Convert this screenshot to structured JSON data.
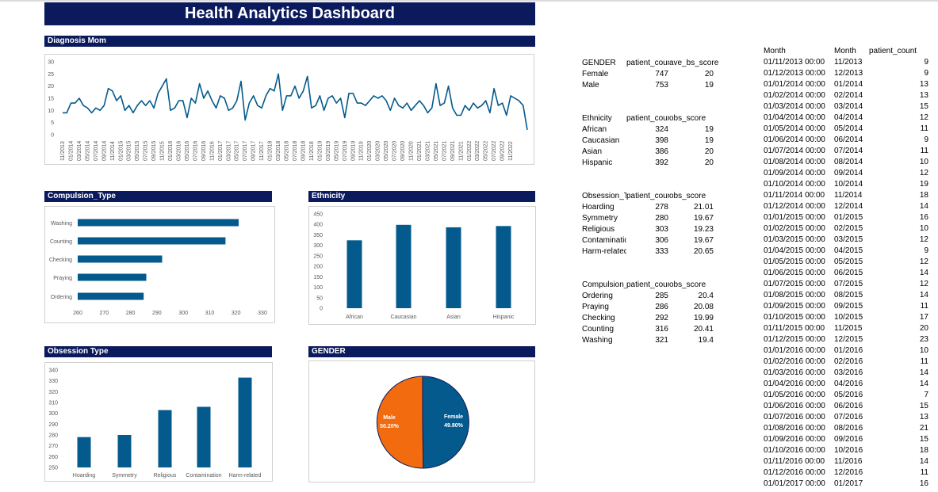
{
  "dashboard": {
    "title": "Health Analytics Dashboard"
  },
  "diagnosis": {
    "header": "Diagnosis Mom",
    "y_ticks": [
      "30",
      "25",
      "20",
      "15",
      "10",
      "5",
      "0"
    ],
    "x_labels": [
      "11/2013",
      "01/2014",
      "03/2014",
      "05/2014",
      "07/2014",
      "09/2014",
      "11/2014",
      "01/2015",
      "03/2015",
      "05/2015",
      "07/2015",
      "09/2015",
      "11/2015",
      "01/2016",
      "03/2016",
      "05/2016",
      "07/2016",
      "09/2016",
      "11/2016",
      "01/2017",
      "03/2017",
      "05/2017",
      "07/2017",
      "09/2017",
      "11/2017",
      "01/2018",
      "03/2018",
      "05/2018",
      "07/2018",
      "09/2018",
      "11/2018",
      "01/2019",
      "03/2019",
      "05/2019",
      "07/2019",
      "09/2019",
      "11/2019",
      "01/2020",
      "03/2020",
      "05/2020",
      "07/2020",
      "09/2020",
      "11/2020",
      "01/2021",
      "03/2021",
      "05/2021",
      "07/2021",
      "09/2021",
      "11/2021",
      "01/2022",
      "03/2022",
      "05/2022",
      "07/2022",
      "09/2022",
      "11/2022"
    ]
  },
  "compulsion": {
    "header": "Compulsion_Type",
    "x_ticks": [
      "260",
      "270",
      "280",
      "290",
      "300",
      "310",
      "320",
      "330"
    ]
  },
  "ethnicity": {
    "header": "Ethnicity",
    "y_ticks": [
      "450",
      "400",
      "350",
      "300",
      "250",
      "200",
      "150",
      "100",
      "50",
      "0"
    ]
  },
  "obsession": {
    "header": "Obsession Type",
    "y_ticks": [
      "340",
      "330",
      "320",
      "310",
      "300",
      "290",
      "280",
      "270",
      "260",
      "250"
    ]
  },
  "gender": {
    "header": "GENDER",
    "male_label": "Male",
    "male_pct": "50.20%",
    "female_label": "Female",
    "female_pct": "49.80%",
    "colors": {
      "male": "#f26b0f",
      "female": "#045a8d"
    }
  },
  "chart_data": [
    {
      "type": "line",
      "title": "Diagnosis Mom",
      "ylim": [
        0,
        30
      ],
      "x": [
        "11/2013",
        "12/2013",
        "01/2014",
        "02/2014",
        "03/2014",
        "04/2014",
        "05/2014",
        "06/2014",
        "07/2014",
        "08/2014",
        "09/2014",
        "10/2014",
        "11/2014",
        "12/2014",
        "01/2015",
        "02/2015",
        "03/2015",
        "04/2015",
        "05/2015",
        "06/2015",
        "07/2015",
        "08/2015",
        "09/2015",
        "10/2015",
        "11/2015",
        "12/2015",
        "01/2016",
        "02/2016",
        "03/2016",
        "04/2016",
        "05/2016",
        "06/2016",
        "07/2016",
        "08/2016",
        "09/2016",
        "10/2016",
        "11/2016",
        "12/2016",
        "01/2017",
        "02/2017",
        "03/2017",
        "04/2017",
        "05/2017",
        "06/2017",
        "07/2017",
        "08/2017",
        "09/2017",
        "10/2017",
        "11/2017",
        "12/2017",
        "01/2018",
        "02/2018",
        "03/2018",
        "04/2018",
        "05/2018",
        "06/2018",
        "07/2018",
        "08/2018",
        "09/2018",
        "10/2018",
        "11/2018",
        "12/2018",
        "01/2019",
        "02/2019",
        "03/2019",
        "04/2019",
        "05/2019",
        "06/2019",
        "07/2019",
        "08/2019",
        "09/2019",
        "10/2019",
        "11/2019",
        "12/2019",
        "01/2020",
        "02/2020",
        "03/2020",
        "04/2020",
        "05/2020",
        "06/2020",
        "07/2020",
        "08/2020",
        "09/2020",
        "10/2020",
        "11/2020",
        "12/2020",
        "01/2021",
        "02/2021",
        "03/2021",
        "04/2021",
        "05/2021",
        "06/2021",
        "07/2021",
        "08/2021",
        "09/2021",
        "10/2021",
        "11/2021",
        "12/2021",
        "01/2022",
        "02/2022",
        "03/2022",
        "04/2022",
        "05/2022",
        "06/2022",
        "07/2022",
        "08/2022",
        "09/2022",
        "10/2022",
        "11/2022"
      ],
      "values": [
        9,
        9,
        13,
        13,
        15,
        12,
        11,
        9,
        11,
        10,
        12,
        19,
        18,
        14,
        16,
        10,
        12,
        9,
        12,
        14,
        12,
        14,
        11,
        17,
        20,
        23,
        10,
        11,
        14,
        14,
        7,
        15,
        13,
        21,
        15,
        18,
        14,
        11,
        16,
        15,
        10,
        11,
        14,
        22,
        6,
        13,
        16,
        12,
        11,
        16,
        19,
        18,
        25,
        10,
        16,
        16,
        20,
        15,
        18,
        24,
        11,
        12,
        16,
        10,
        15,
        16,
        13,
        15,
        7,
        17,
        17,
        13,
        13,
        12,
        14,
        16,
        15,
        16,
        14,
        10,
        15,
        12,
        11,
        13,
        10,
        12,
        14,
        12,
        9,
        11,
        21,
        12,
        13,
        20,
        11,
        8,
        8,
        12,
        10,
        13,
        11,
        12,
        14,
        9,
        19,
        12,
        13,
        8,
        16,
        15,
        14,
        12,
        2
      ]
    },
    {
      "type": "bar",
      "title": "Compulsion_Type",
      "orientation": "horizontal",
      "categories": [
        "Washing",
        "Counting",
        "Checking",
        "Praying",
        "Ordering"
      ],
      "values": [
        321,
        316,
        292,
        286,
        285
      ],
      "xlim": [
        260,
        330
      ]
    },
    {
      "type": "bar",
      "title": "Ethnicity",
      "categories": [
        "African",
        "Caucasian",
        "Asian",
        "Hispanic"
      ],
      "values": [
        324,
        398,
        386,
        392
      ],
      "ylim": [
        0,
        450
      ]
    },
    {
      "type": "bar",
      "title": "Obsession Type",
      "categories": [
        "Hoarding",
        "Symmetry",
        "Religious",
        "Contamination",
        "Harm-related"
      ],
      "values": [
        278,
        280,
        303,
        306,
        333
      ],
      "ylim": [
        250,
        340
      ]
    },
    {
      "type": "pie",
      "title": "GENDER",
      "categories": [
        "Male",
        "Female"
      ],
      "values": [
        50.2,
        49.8
      ]
    }
  ],
  "tables": {
    "gender": {
      "headers": [
        "GENDER",
        "patient_count",
        "ave_bs_score"
      ],
      "rows": [
        [
          "Female",
          "747",
          "20"
        ],
        [
          "Male",
          "753",
          "19"
        ]
      ]
    },
    "ethnicity": {
      "headers": [
        "Ethnicity",
        "patient_count",
        "obs_score"
      ],
      "rows": [
        [
          "African",
          "324",
          "19"
        ],
        [
          "Caucasian",
          "398",
          "19"
        ],
        [
          "Asian",
          "386",
          "20"
        ],
        [
          "Hispanic",
          "392",
          "20"
        ]
      ]
    },
    "obsession": {
      "headers": [
        "Obsession_Type",
        "patient_count",
        "obs_score"
      ],
      "rows": [
        [
          "Hoarding",
          "278",
          "21.01"
        ],
        [
          "Symmetry",
          "280",
          "19.67"
        ],
        [
          "Religious",
          "303",
          "19.23"
        ],
        [
          "Contamination",
          "306",
          "19.67"
        ],
        [
          "Harm-related",
          "333",
          "20.65"
        ]
      ]
    },
    "compulsion": {
      "headers": [
        "Compulsion_Type",
        "patient_count",
        "obs_score"
      ],
      "rows": [
        [
          "Ordering",
          "285",
          "20.4"
        ],
        [
          "Praying",
          "286",
          "20.08"
        ],
        [
          "Checking",
          "292",
          "19.99"
        ],
        [
          "Counting",
          "316",
          "20.41"
        ],
        [
          "Washing",
          "321",
          "19.4"
        ]
      ]
    }
  },
  "month_table": {
    "headers": [
      "Month",
      "Month",
      "patient_count"
    ],
    "rows": [
      [
        "01/11/2013 00:00",
        "11/2013",
        "9"
      ],
      [
        "01/12/2013 00:00",
        "12/2013",
        "9"
      ],
      [
        "01/01/2014 00:00",
        "01/2014",
        "13"
      ],
      [
        "01/02/2014 00:00",
        "02/2014",
        "13"
      ],
      [
        "01/03/2014 00:00",
        "03/2014",
        "15"
      ],
      [
        "01/04/2014 00:00",
        "04/2014",
        "12"
      ],
      [
        "01/05/2014 00:00",
        "05/2014",
        "11"
      ],
      [
        "01/06/2014 00:00",
        "06/2014",
        "9"
      ],
      [
        "01/07/2014 00:00",
        "07/2014",
        "11"
      ],
      [
        "01/08/2014 00:00",
        "08/2014",
        "10"
      ],
      [
        "01/09/2014 00:00",
        "09/2014",
        "12"
      ],
      [
        "01/10/2014 00:00",
        "10/2014",
        "19"
      ],
      [
        "01/11/2014 00:00",
        "11/2014",
        "18"
      ],
      [
        "01/12/2014 00:00",
        "12/2014",
        "14"
      ],
      [
        "01/01/2015 00:00",
        "01/2015",
        "16"
      ],
      [
        "01/02/2015 00:00",
        "02/2015",
        "10"
      ],
      [
        "01/03/2015 00:00",
        "03/2015",
        "12"
      ],
      [
        "01/04/2015 00:00",
        "04/2015",
        "9"
      ],
      [
        "01/05/2015 00:00",
        "05/2015",
        "12"
      ],
      [
        "01/06/2015 00:00",
        "06/2015",
        "14"
      ],
      [
        "01/07/2015 00:00",
        "07/2015",
        "12"
      ],
      [
        "01/08/2015 00:00",
        "08/2015",
        "14"
      ],
      [
        "01/09/2015 00:00",
        "09/2015",
        "11"
      ],
      [
        "01/10/2015 00:00",
        "10/2015",
        "17"
      ],
      [
        "01/11/2015 00:00",
        "11/2015",
        "20"
      ],
      [
        "01/12/2015 00:00",
        "12/2015",
        "23"
      ],
      [
        "01/01/2016 00:00",
        "01/2016",
        "10"
      ],
      [
        "01/02/2016 00:00",
        "02/2016",
        "11"
      ],
      [
        "01/03/2016 00:00",
        "03/2016",
        "14"
      ],
      [
        "01/04/2016 00:00",
        "04/2016",
        "14"
      ],
      [
        "01/05/2016 00:00",
        "05/2016",
        "7"
      ],
      [
        "01/06/2016 00:00",
        "06/2016",
        "15"
      ],
      [
        "01/07/2016 00:00",
        "07/2016",
        "13"
      ],
      [
        "01/08/2016 00:00",
        "08/2016",
        "21"
      ],
      [
        "01/09/2016 00:00",
        "09/2016",
        "15"
      ],
      [
        "01/10/2016 00:00",
        "10/2016",
        "18"
      ],
      [
        "01/11/2016 00:00",
        "11/2016",
        "14"
      ],
      [
        "01/12/2016 00:00",
        "12/2016",
        "11"
      ],
      [
        "01/01/2017 00:00",
        "01/2017",
        "16"
      ]
    ]
  }
}
